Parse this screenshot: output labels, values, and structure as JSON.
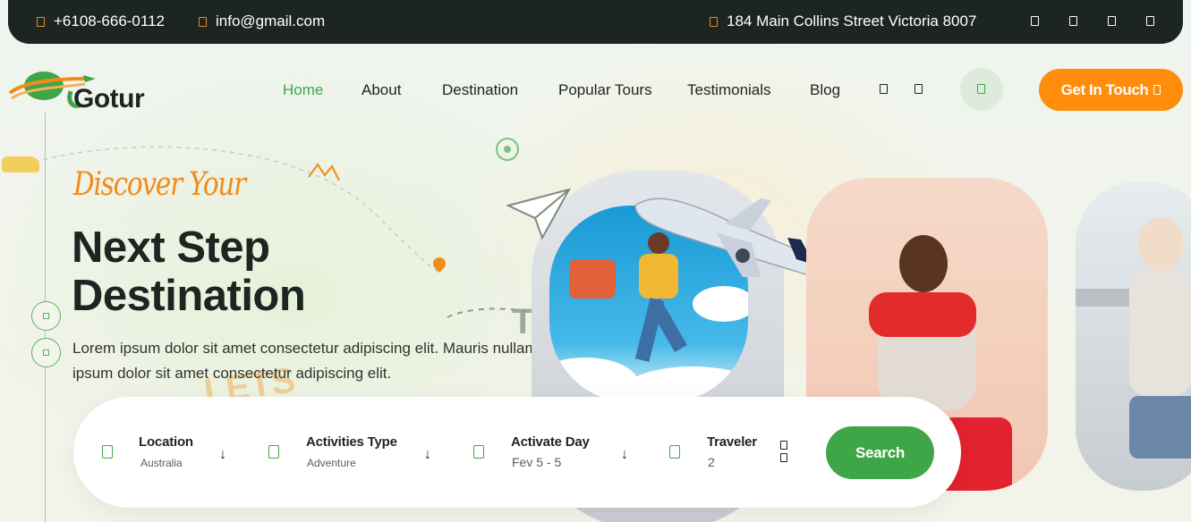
{
  "topbar": {
    "phone": "+6108-666-0112",
    "email": "info@gmail.com",
    "address": "184 Main Collins Street Victoria 8007",
    "social_icons": [
      "facebook-icon",
      "twitter-icon",
      "linkedin-icon",
      "youtube-icon"
    ]
  },
  "brand": {
    "name": "Gotur"
  },
  "nav": {
    "items": [
      "Home",
      "About",
      "Destination",
      "Popular Tours",
      "Testimonials",
      "Blog"
    ],
    "active": "Home",
    "cta_label": "Get In Touch"
  },
  "hero": {
    "subtitle": "Discover Your",
    "title_line1": "Next Step",
    "title_line2": "Destination",
    "description": "Lorem ipsum dolor sit amet consectetur adipiscing elit. Mauris nullam the Lorem ipsum dolor sit amet consectetur adipiscing elit.",
    "decor_to": "TO",
    "decor_lets": "LETS"
  },
  "search": {
    "fields": [
      {
        "label": "Location",
        "value": "Australia"
      },
      {
        "label": "Activities Type",
        "value": "Adventure"
      },
      {
        "label": "Activate Day",
        "value": "Fev 5 - 5"
      },
      {
        "label": "Traveler",
        "value": "2"
      }
    ],
    "button_label": "Search"
  },
  "colors": {
    "accent_green": "#3fa648",
    "accent_orange": "#ff8d0b",
    "dark": "#1c2521"
  }
}
